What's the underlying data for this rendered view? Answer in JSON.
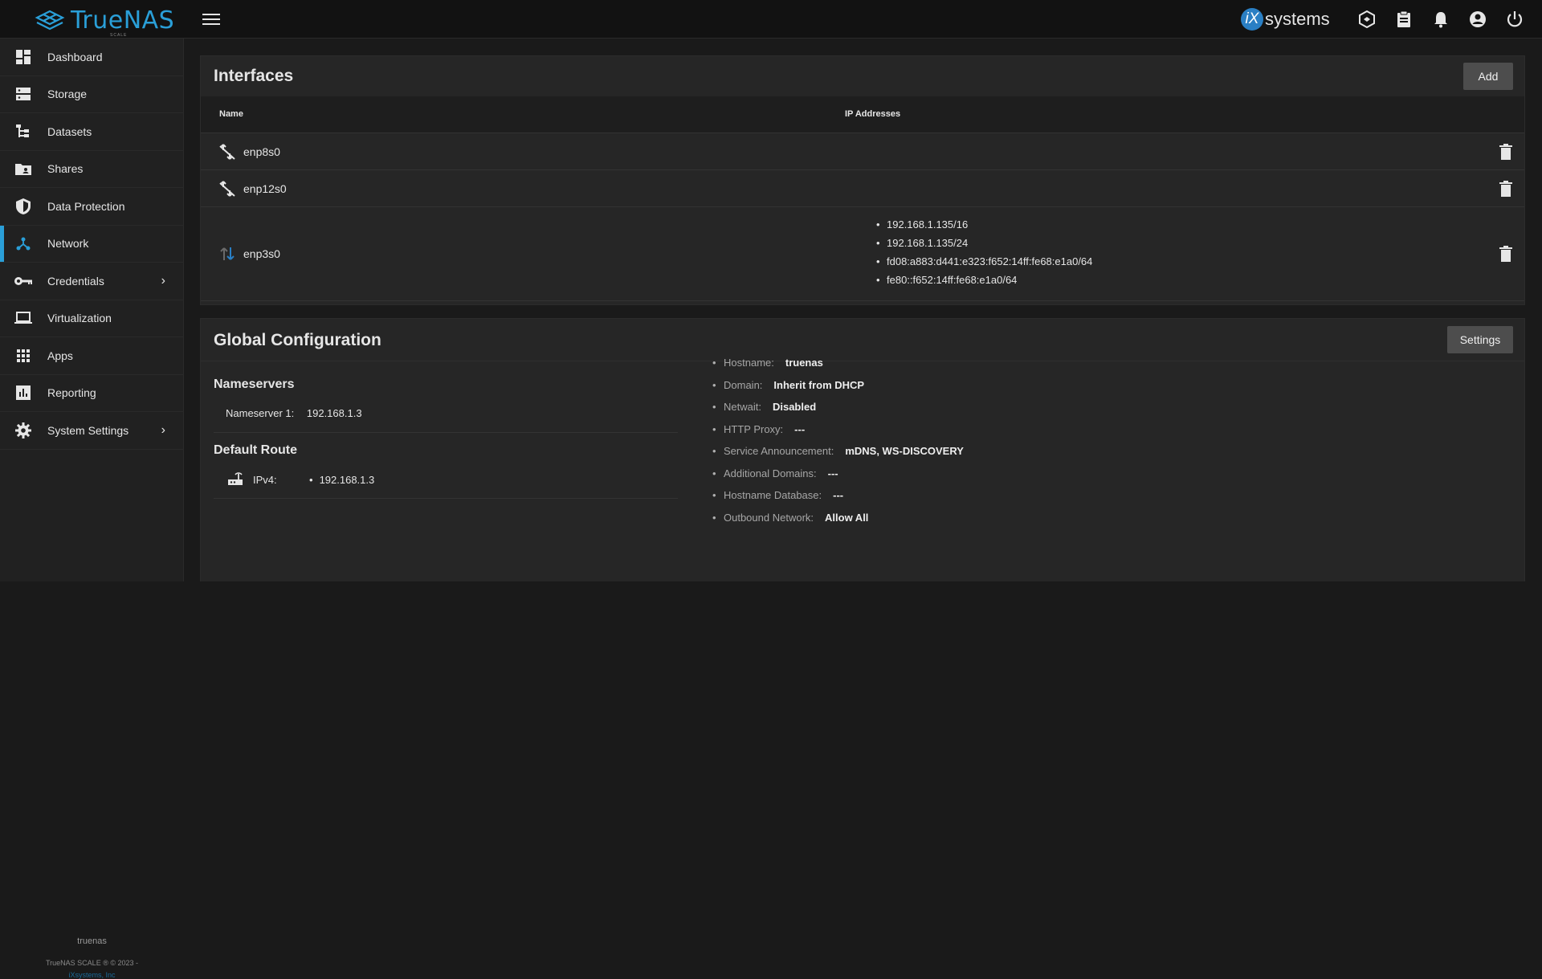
{
  "app": {
    "brand": "TrueNAS",
    "edition": "SCALE",
    "vendor_mark": "iX",
    "vendor_word": "systems"
  },
  "topbar_icons": [
    "truecommand-icon",
    "jobs-clipboard-icon",
    "bell-icon",
    "account-icon",
    "power-icon"
  ],
  "sidebar": {
    "items": [
      {
        "label": "Dashboard",
        "icon": "dashboard-icon"
      },
      {
        "label": "Storage",
        "icon": "storage-icon"
      },
      {
        "label": "Datasets",
        "icon": "datasets-icon"
      },
      {
        "label": "Shares",
        "icon": "shares-icon"
      },
      {
        "label": "Data Protection",
        "icon": "shield-icon"
      },
      {
        "label": "Network",
        "icon": "network-icon",
        "active": true
      },
      {
        "label": "Credentials",
        "icon": "key-icon",
        "expandable": true
      },
      {
        "label": "Virtualization",
        "icon": "laptop-icon"
      },
      {
        "label": "Apps",
        "icon": "apps-grid-icon"
      },
      {
        "label": "Reporting",
        "icon": "chart-icon"
      },
      {
        "label": "System Settings",
        "icon": "gear-icon",
        "expandable": true
      }
    ],
    "arrow": "›",
    "hostname": "truenas",
    "copyright": "TrueNAS SCALE ® © 2023 -",
    "company": "iXsystems, Inc"
  },
  "interfaces": {
    "title": "Interfaces",
    "add_label": "Add",
    "columns": {
      "name": "Name",
      "ip": "IP Addresses"
    },
    "rows": [
      {
        "name": "enp8s0",
        "state": "down",
        "ips": []
      },
      {
        "name": "enp12s0",
        "state": "down",
        "ips": []
      },
      {
        "name": "enp3s0",
        "state": "up",
        "ips": [
          "192.168.1.135/16",
          "192.168.1.135/24",
          "fd08:a883:d441:e323:f652:14ff:fe68:e1a0/64",
          "fe80::f652:14ff:fe68:e1a0/64"
        ]
      }
    ]
  },
  "global": {
    "title": "Global Configuration",
    "settings_label": "Settings",
    "nameservers_title": "Nameservers",
    "nameserver1_key": "Nameserver 1:",
    "nameserver1_val": "192.168.1.3",
    "default_route_title": "Default Route",
    "ipv4_key": "IPv4:",
    "ipv4_val": "192.168.1.3",
    "info": [
      {
        "k": "Hostname:",
        "v": "truenas"
      },
      {
        "k": "Domain:",
        "v": "Inherit from DHCP"
      },
      {
        "k": "Netwait:",
        "v": "Disabled"
      },
      {
        "k": "HTTP Proxy:",
        "v": "---"
      },
      {
        "k": "Service Announcement:",
        "v": "mDNS, WS-DISCOVERY"
      },
      {
        "k": "Additional Domains:",
        "v": "---"
      },
      {
        "k": "Hostname Database:",
        "v": "---"
      },
      {
        "k": "Outbound Network:",
        "v": "Allow All"
      }
    ]
  },
  "colors": {
    "accent": "#2a9fd8",
    "background": "#1a1a1a",
    "card": "#262626",
    "sidebar": "#212121"
  }
}
